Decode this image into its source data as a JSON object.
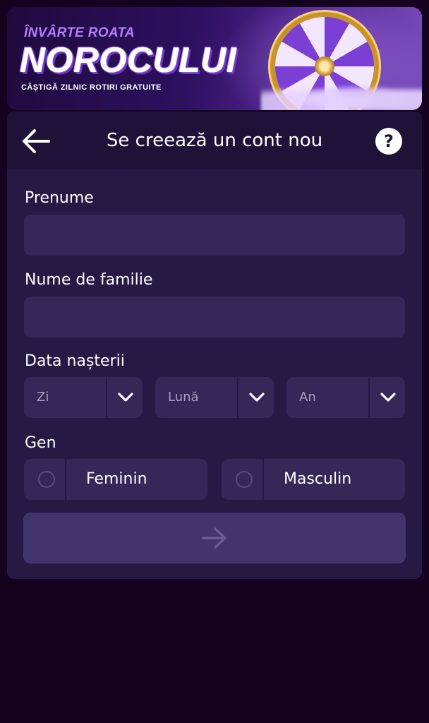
{
  "banner": {
    "subtitle": "ÎNVÂRTE ROATA",
    "title": "NOROCULUI",
    "tagline": "CÂȘTIGĂ ZILNIC ROTIRI GRATUITE"
  },
  "header": {
    "title": "Se creează un cont nou",
    "back_icon": "arrow-left-icon",
    "help_label": "?"
  },
  "form": {
    "first_name": {
      "label": "Prenume",
      "value": "",
      "placeholder": ""
    },
    "last_name": {
      "label": "Nume de familie",
      "value": "",
      "placeholder": ""
    },
    "birth_date": {
      "label": "Data nașterii",
      "day": "Zi",
      "month": "Lună",
      "year": "An"
    },
    "gender": {
      "label": "Gen",
      "options": [
        "Feminin",
        "Masculin"
      ],
      "selected": null
    },
    "submit_icon": "arrow-right-icon"
  },
  "colors": {
    "background": "#14021f",
    "card": "#261a45",
    "header": "#1f1238",
    "field": "#352858",
    "submit": "#42356e"
  }
}
